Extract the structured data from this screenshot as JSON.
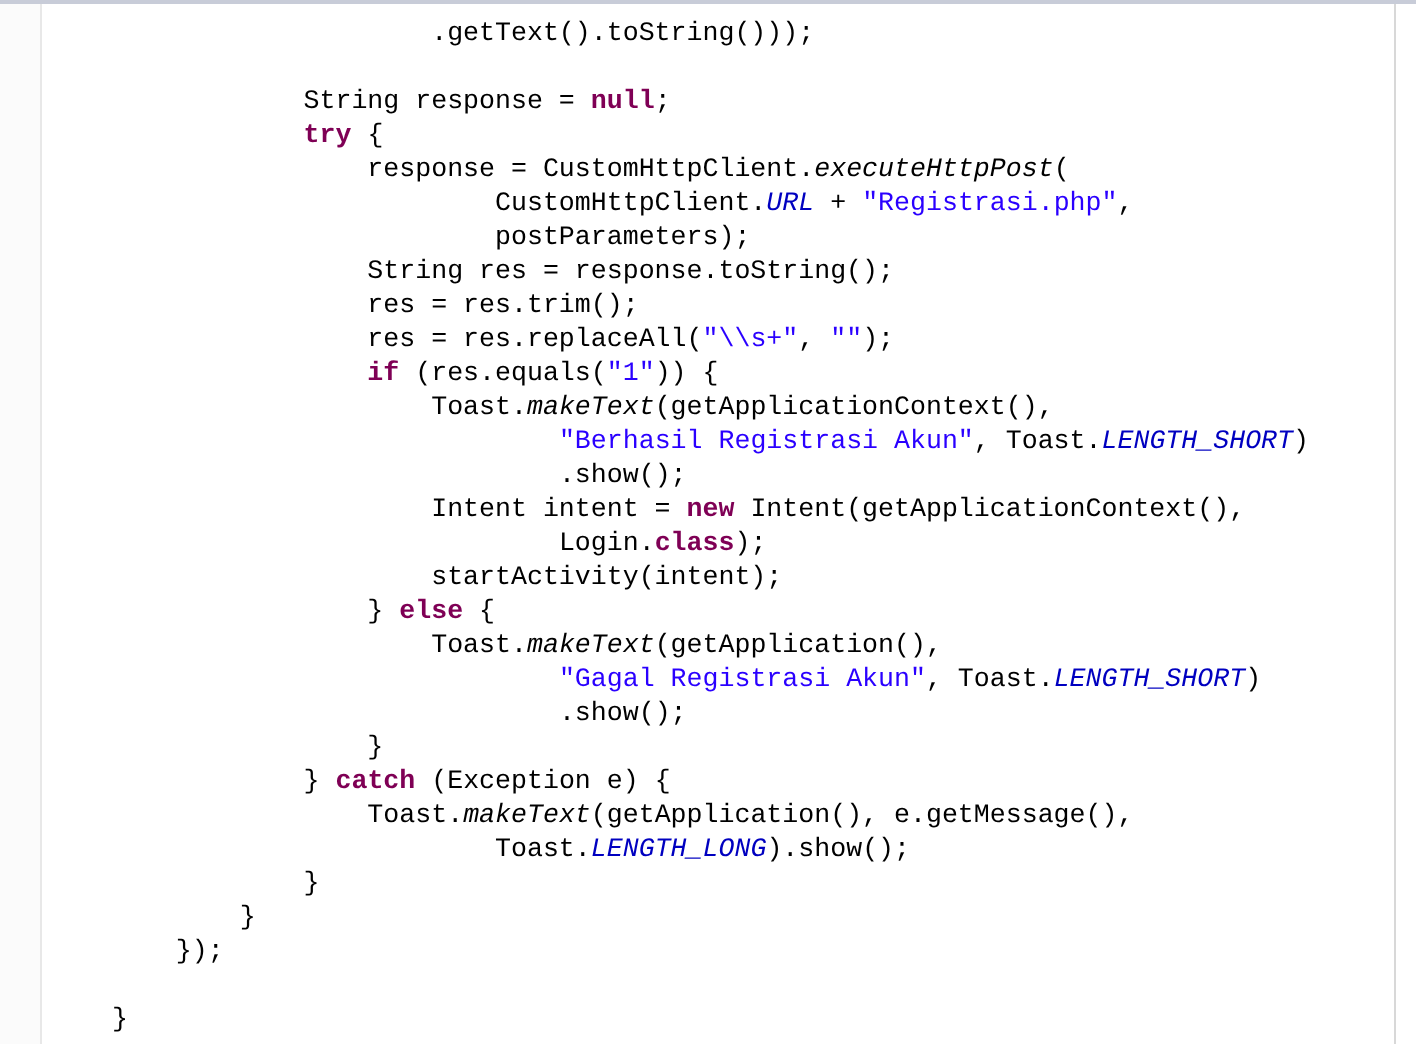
{
  "editor": {
    "lines": [
      {
        "kind": "code",
        "tokens": [
          {
            "kind": "plain",
            "text": "                    .getText().toString()));"
          }
        ]
      },
      {
        "kind": "blank"
      },
      {
        "kind": "code",
        "tokens": [
          {
            "kind": "plain",
            "text": "            String response = "
          },
          {
            "kind": "keyword",
            "text": "null"
          },
          {
            "kind": "plain",
            "text": ";"
          }
        ]
      },
      {
        "kind": "code",
        "tokens": [
          {
            "kind": "keyword",
            "text": "            try"
          },
          {
            "kind": "plain",
            "text": " {"
          }
        ]
      },
      {
        "kind": "code",
        "tokens": [
          {
            "kind": "plain",
            "text": "                response = CustomHttpClient."
          },
          {
            "kind": "static",
            "text": "executeHttpPost"
          },
          {
            "kind": "plain",
            "text": "("
          }
        ]
      },
      {
        "kind": "code",
        "tokens": [
          {
            "kind": "plain",
            "text": "                        CustomHttpClient."
          },
          {
            "kind": "constant",
            "text": "URL"
          },
          {
            "kind": "plain",
            "text": " + "
          },
          {
            "kind": "string",
            "text": "\"Registrasi.php\""
          },
          {
            "kind": "plain",
            "text": ","
          }
        ]
      },
      {
        "kind": "code",
        "tokens": [
          {
            "kind": "plain",
            "text": "                        postParameters);"
          }
        ]
      },
      {
        "kind": "code",
        "tokens": [
          {
            "kind": "plain",
            "text": "                String res = response.toString();"
          }
        ]
      },
      {
        "kind": "code",
        "tokens": [
          {
            "kind": "plain",
            "text": "                res = res.trim();"
          }
        ]
      },
      {
        "kind": "code",
        "tokens": [
          {
            "kind": "plain",
            "text": "                res = res.replaceAll("
          },
          {
            "kind": "string",
            "text": "\"\\\\s+\""
          },
          {
            "kind": "plain",
            "text": ", "
          },
          {
            "kind": "string",
            "text": "\"\""
          },
          {
            "kind": "plain",
            "text": ");"
          }
        ]
      },
      {
        "kind": "code",
        "tokens": [
          {
            "kind": "keyword",
            "text": "                if"
          },
          {
            "kind": "plain",
            "text": " (res.equals("
          },
          {
            "kind": "string",
            "text": "\"1\""
          },
          {
            "kind": "plain",
            "text": ")) {"
          }
        ]
      },
      {
        "kind": "code",
        "tokens": [
          {
            "kind": "plain",
            "text": "                    Toast."
          },
          {
            "kind": "static",
            "text": "makeText"
          },
          {
            "kind": "plain",
            "text": "(getApplicationContext(),"
          }
        ]
      },
      {
        "kind": "code",
        "tokens": [
          {
            "kind": "string",
            "text": "                            \"Berhasil Registrasi Akun\""
          },
          {
            "kind": "plain",
            "text": ", Toast."
          },
          {
            "kind": "constant",
            "text": "LENGTH_SHORT"
          },
          {
            "kind": "plain",
            "text": ")"
          }
        ]
      },
      {
        "kind": "code",
        "tokens": [
          {
            "kind": "plain",
            "text": "                            .show();"
          }
        ]
      },
      {
        "kind": "code",
        "tokens": [
          {
            "kind": "plain",
            "text": "                    Intent intent = "
          },
          {
            "kind": "keyword",
            "text": "new"
          },
          {
            "kind": "plain",
            "text": " Intent(getApplicationContext(),"
          }
        ]
      },
      {
        "kind": "code",
        "tokens": [
          {
            "kind": "plain",
            "text": "                            Login."
          },
          {
            "kind": "keyword",
            "text": "class"
          },
          {
            "kind": "plain",
            "text": ");"
          }
        ]
      },
      {
        "kind": "code",
        "tokens": [
          {
            "kind": "plain",
            "text": "                    startActivity(intent);"
          }
        ]
      },
      {
        "kind": "code",
        "tokens": [
          {
            "kind": "plain",
            "text": "                } "
          },
          {
            "kind": "keyword",
            "text": "else"
          },
          {
            "kind": "plain",
            "text": " {"
          }
        ]
      },
      {
        "kind": "code",
        "tokens": [
          {
            "kind": "plain",
            "text": "                    Toast."
          },
          {
            "kind": "static",
            "text": "makeText"
          },
          {
            "kind": "plain",
            "text": "(getApplication(),"
          }
        ]
      },
      {
        "kind": "code",
        "tokens": [
          {
            "kind": "string",
            "text": "                            \"Gagal Registrasi Akun\""
          },
          {
            "kind": "plain",
            "text": ", Toast."
          },
          {
            "kind": "constant",
            "text": "LENGTH_SHORT"
          },
          {
            "kind": "plain",
            "text": ")"
          }
        ]
      },
      {
        "kind": "code",
        "tokens": [
          {
            "kind": "plain",
            "text": "                            .show();"
          }
        ]
      },
      {
        "kind": "code",
        "tokens": [
          {
            "kind": "plain",
            "text": "                }"
          }
        ]
      },
      {
        "kind": "code",
        "tokens": [
          {
            "kind": "plain",
            "text": "            } "
          },
          {
            "kind": "keyword",
            "text": "catch"
          },
          {
            "kind": "plain",
            "text": " (Exception e) {"
          }
        ]
      },
      {
        "kind": "code",
        "tokens": [
          {
            "kind": "plain",
            "text": "                Toast."
          },
          {
            "kind": "static",
            "text": "makeText"
          },
          {
            "kind": "plain",
            "text": "(getApplication(), e.getMessage(),"
          }
        ]
      },
      {
        "kind": "code",
        "tokens": [
          {
            "kind": "plain",
            "text": "                        Toast."
          },
          {
            "kind": "constant",
            "text": "LENGTH_LONG"
          },
          {
            "kind": "plain",
            "text": ").show();"
          }
        ]
      },
      {
        "kind": "code",
        "tokens": [
          {
            "kind": "plain",
            "text": "            }"
          }
        ]
      },
      {
        "kind": "code",
        "tokens": [
          {
            "kind": "plain",
            "text": "        }"
          }
        ]
      },
      {
        "kind": "code",
        "tokens": [
          {
            "kind": "plain",
            "text": "    });"
          }
        ]
      },
      {
        "kind": "blank"
      },
      {
        "kind": "code",
        "tokens": [
          {
            "kind": "plain",
            "text": "}"
          }
        ]
      }
    ]
  }
}
